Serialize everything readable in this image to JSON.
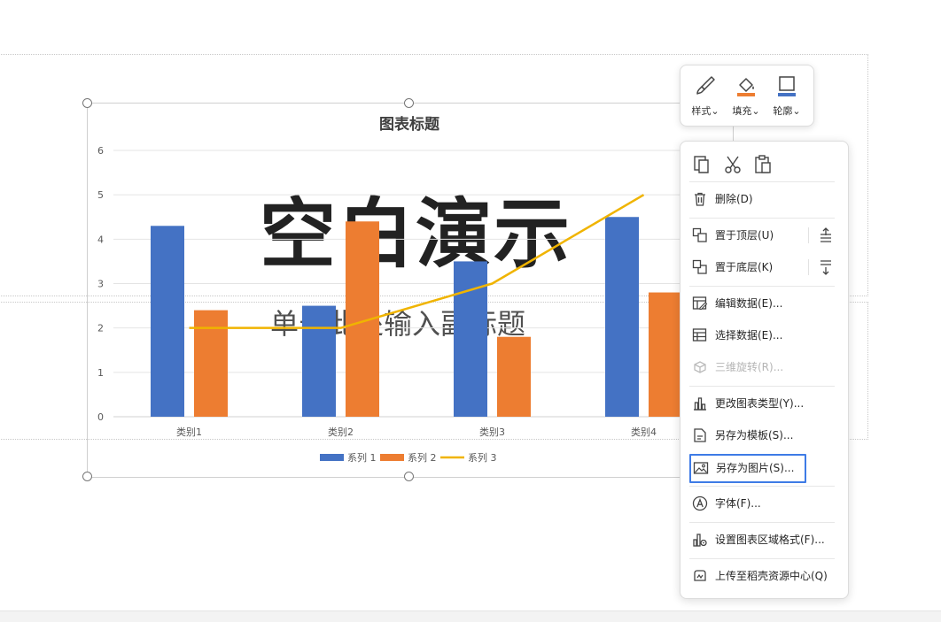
{
  "slide": {
    "title": "空白演示",
    "subtitle": "单击此处输入副标题"
  },
  "chart_data": {
    "type": "bar",
    "title": "图表标题",
    "categories": [
      "类别1",
      "类别2",
      "类别3",
      "类别4"
    ],
    "series": [
      {
        "name": "系列 1",
        "kind": "bar",
        "color": "#4472c4",
        "values": [
          4.3,
          2.5,
          3.5,
          4.5
        ]
      },
      {
        "name": "系列 2",
        "kind": "bar",
        "color": "#ed7d31",
        "values": [
          2.4,
          4.4,
          1.8,
          2.8
        ]
      },
      {
        "name": "系列 3",
        "kind": "line",
        "color": "#f0b400",
        "values": [
          2,
          2,
          3,
          5
        ]
      }
    ],
    "ylim": [
      0,
      6
    ],
    "yticks": [
      "0",
      "1",
      "2",
      "3",
      "4",
      "5",
      "6"
    ],
    "grid": true,
    "legend_position": "bottom"
  },
  "float_toolbar": {
    "style_label": "样式",
    "fill_label": "填充",
    "outline_label": "轮廓",
    "fill_color": "#ed7d31",
    "outline_color": "#4472c4"
  },
  "context_menu": {
    "top_icons": [
      "copy-icon",
      "cut-icon",
      "paste-icon"
    ],
    "delete": "删除(D)",
    "bring_to_front": "置于顶层(U)",
    "send_to_back": "置于底层(K)",
    "edit_data": "编辑数据(E)...",
    "select_data": "选择数据(E)...",
    "rotation_3d": "三维旋转(R)...",
    "change_chart_type": "更改图表类型(Y)...",
    "save_as_template": "另存为模板(S)...",
    "save_as_picture": "另存为图片(S)...",
    "font": "字体(F)...",
    "format_chart_area": "设置图表区域格式(F)...",
    "upload_resource": "上传至稻壳资源中心(Q)"
  }
}
